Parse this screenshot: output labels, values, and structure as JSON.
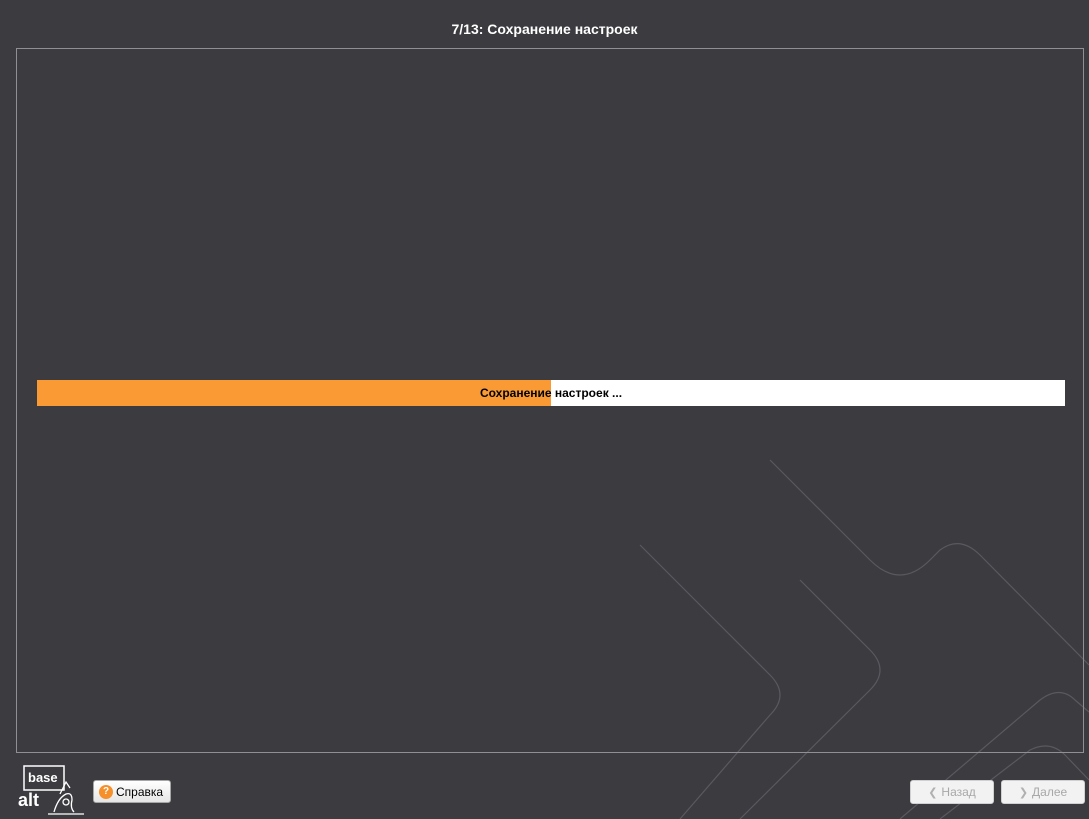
{
  "window": {
    "title": "7/13: Сохранение настроек"
  },
  "progress": {
    "label": "Сохранение настроек ...",
    "fraction": 0.5
  },
  "logo": {
    "line1": "base",
    "line2": "alt"
  },
  "buttons": {
    "help": "Справка",
    "back": "Назад",
    "next": "Далее"
  },
  "icons": {
    "help": "question-circle-icon",
    "back": "chevron-left-icon",
    "next": "chevron-right-icon"
  },
  "colors": {
    "background": "#3c3b40",
    "progress_fill": "#f99a35",
    "progress_track": "#ffffff"
  }
}
